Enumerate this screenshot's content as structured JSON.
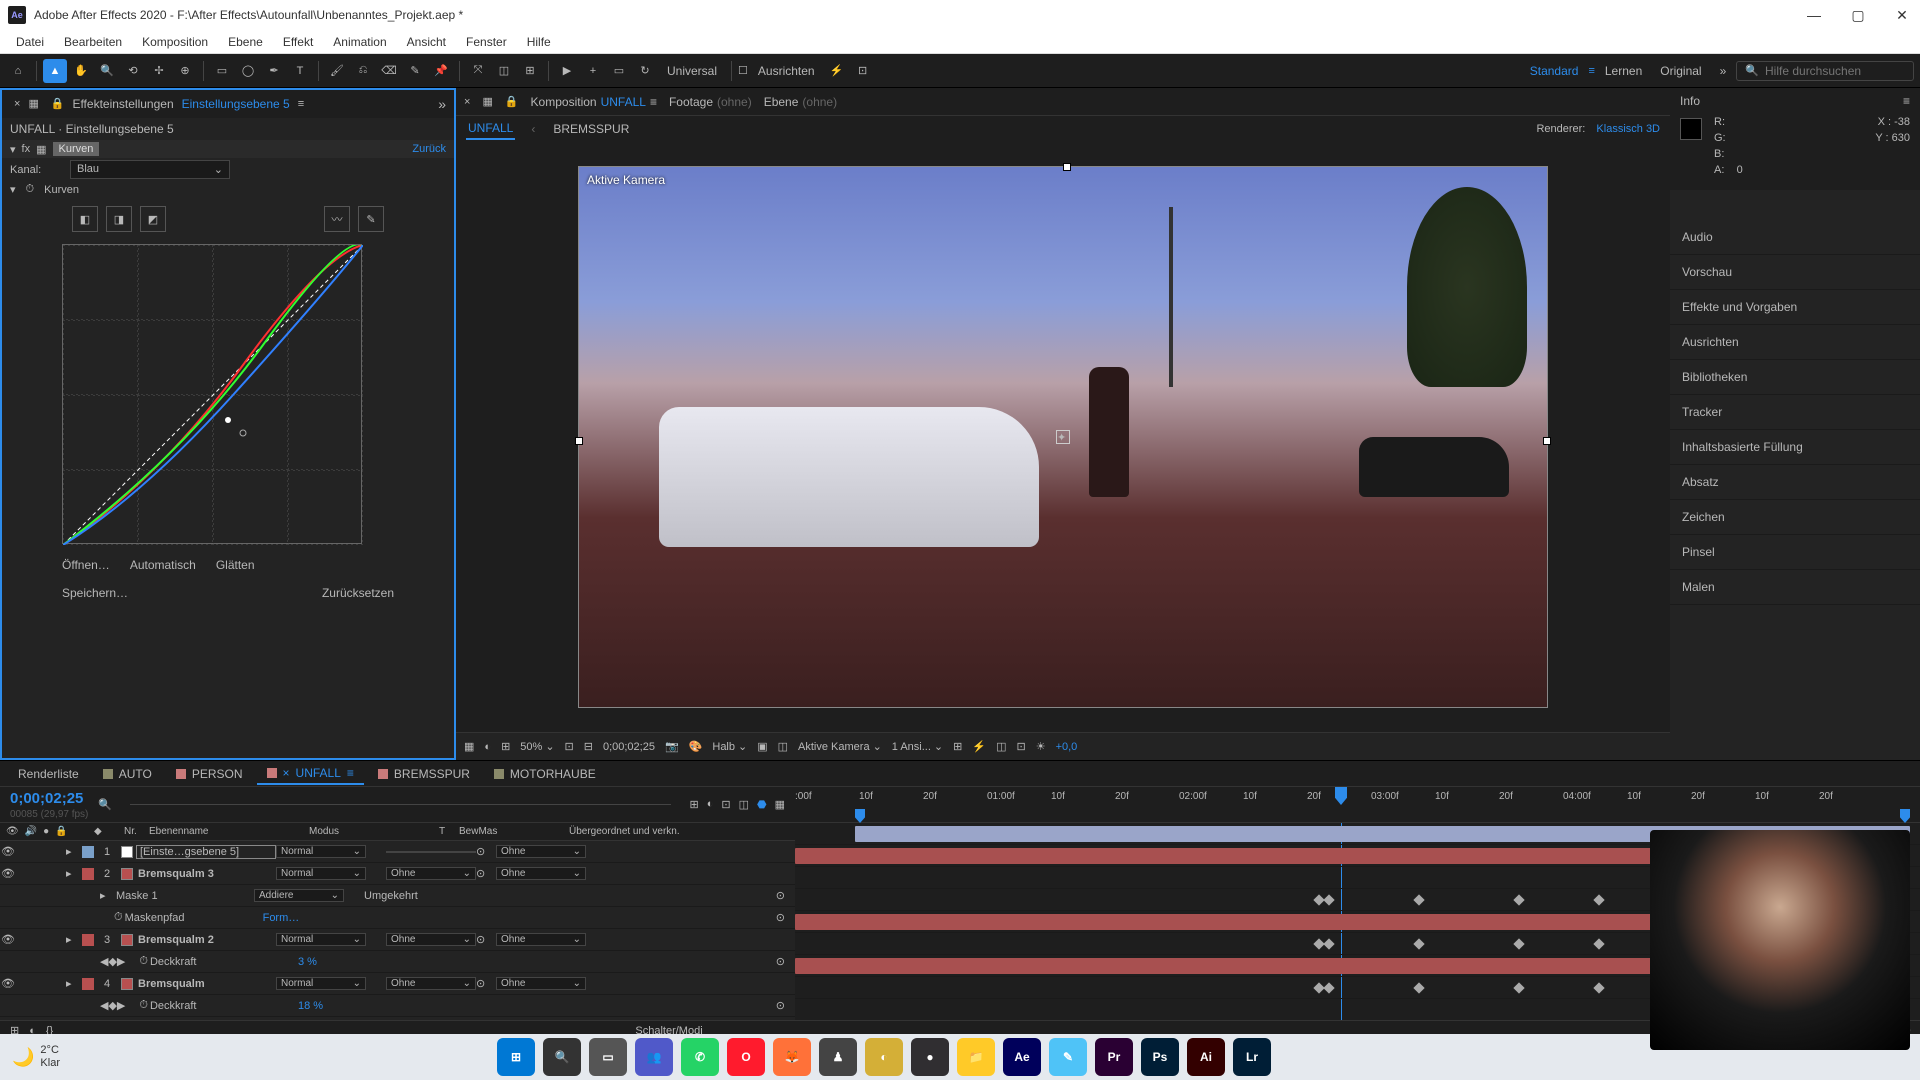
{
  "titlebar": {
    "app": "Adobe After Effects 2020",
    "path": "F:\\After Effects\\Autounfall\\Unbenanntes_Projekt.aep *"
  },
  "menubar": [
    "Datei",
    "Bearbeiten",
    "Komposition",
    "Ebene",
    "Effekt",
    "Animation",
    "Ansicht",
    "Fenster",
    "Hilfe"
  ],
  "toolbar": {
    "universal": "Universal",
    "ausrichten": "Ausrichten",
    "workspaces": [
      "Standard",
      "Lernen",
      "Original"
    ],
    "search_placeholder": "Hilfe durchsuchen"
  },
  "effects_panel": {
    "tab_label": "Effekteinstellungen",
    "tab_item": "Einstellungsebene 5",
    "breadcrumb": "UNFALL · Einstellungsebene 5",
    "fx_name": "Kurven",
    "reset": "Zurück",
    "channel_label": "Kanal:",
    "channel_value": "Blau",
    "curves_label": "Kurven",
    "actions": {
      "open": "Öffnen…",
      "auto": "Automatisch",
      "smooth": "Glätten",
      "save": "Speichern…",
      "reset": "Zurücksetzen"
    }
  },
  "comp_panel": {
    "tabs": [
      {
        "prefix": "Komposition",
        "name": "UNFALL"
      },
      {
        "prefix": "Footage",
        "name": "(ohne)"
      },
      {
        "prefix": "Ebene",
        "name": "(ohne)"
      }
    ],
    "subtabs": [
      "UNFALL",
      "BREMSSPUR"
    ],
    "renderer_label": "Renderer:",
    "renderer_value": "Klassisch 3D",
    "active_camera": "Aktive Kamera",
    "controls": {
      "zoom": "50%",
      "timecode": "0;00;02;25",
      "res": "Halb",
      "camera": "Aktive Kamera",
      "views": "1 Ansi...",
      "exposure": "+0,0"
    }
  },
  "info": {
    "title": "Info",
    "R": "R:",
    "G": "G:",
    "B": "B:",
    "A": "A:",
    "Aval": "0",
    "X": "X : -38",
    "Y": "Y : 630"
  },
  "right_panels": [
    "Audio",
    "Vorschau",
    "Effekte und Vorgaben",
    "Ausrichten",
    "Bibliotheken",
    "Tracker",
    "Inhaltsbasierte Füllung",
    "Absatz",
    "Zeichen",
    "Pinsel",
    "Malen"
  ],
  "timeline": {
    "tabs": [
      {
        "label": "Renderliste",
        "color": ""
      },
      {
        "label": "AUTO",
        "color": "#8a8a6a"
      },
      {
        "label": "PERSON",
        "color": "#c97a7a"
      },
      {
        "label": "UNFALL",
        "color": "#c97a7a",
        "active": true
      },
      {
        "label": "BREMSSPUR",
        "color": "#c97a7a"
      },
      {
        "label": "MOTORHAUBE",
        "color": "#8a8a6a"
      }
    ],
    "timecode": "0;00;02;25",
    "subtime": "00085 (29,97 fps)",
    "cols": {
      "nr": "Nr.",
      "name": "Ebenenname",
      "modus": "Modus",
      "t": "T",
      "bewmas": "BewMas",
      "parent": "Übergeordnet und verkn."
    },
    "ruler": [
      ":00f",
      "10f",
      "20f",
      "01:00f",
      "10f",
      "20f",
      "02:00f",
      "10f",
      "20f",
      "03:00f",
      "10f",
      "20f",
      "04:00f",
      "10f",
      "20f",
      "10f",
      "20f"
    ],
    "layers": [
      {
        "num": "1",
        "color": "#7aa0c9",
        "sq": "#fff",
        "name": "[Einste…gsebene 5]",
        "mode": "Normal",
        "trk": "",
        "parent": "Ohne",
        "boxed": true
      },
      {
        "num": "2",
        "color": "#b85050",
        "sq": "#b85050",
        "name": "Bremsqualm 3",
        "mode": "Normal",
        "trk": "Ohne",
        "parent": "Ohne",
        "bold": true
      },
      {
        "sub": true,
        "name": "Maske 1",
        "mode": "Addiere",
        "extra": "Umgekehrt"
      },
      {
        "sub": true,
        "icon": "path",
        "name": "Maskenpfad",
        "mode_link": "Form…"
      },
      {
        "num": "3",
        "color": "#b85050",
        "sq": "#b85050",
        "name": "Bremsqualm 2",
        "mode": "Normal",
        "trk": "Ohne",
        "parent": "Ohne",
        "bold": true
      },
      {
        "sub": true,
        "icon": "stopwatch",
        "name": "Deckkraft",
        "value": "3 %"
      },
      {
        "num": "4",
        "color": "#b85050",
        "sq": "#b85050",
        "name": "Bremsqualm",
        "mode": "Normal",
        "trk": "Ohne",
        "parent": "Ohne",
        "bold": true
      },
      {
        "sub": true,
        "icon": "stopwatch",
        "name": "Deckkraft",
        "value": "18 %"
      }
    ],
    "footer": "Schalter/Modi"
  },
  "weather": {
    "temp": "2°C",
    "desc": "Klar"
  },
  "task_apps": [
    {
      "name": "start",
      "bg": "#0078d4",
      "txt": "⊞"
    },
    {
      "name": "search",
      "bg": "#333",
      "txt": "🔍"
    },
    {
      "name": "taskview",
      "bg": "#555",
      "txt": "▭"
    },
    {
      "name": "teams",
      "bg": "#5059c9",
      "txt": "👥"
    },
    {
      "name": "whatsapp",
      "bg": "#25d366",
      "txt": "✆"
    },
    {
      "name": "opera",
      "bg": "#ff1b2d",
      "txt": "O"
    },
    {
      "name": "firefox",
      "bg": "#ff7139",
      "txt": "🦊"
    },
    {
      "name": "app1",
      "bg": "#444",
      "txt": "♟"
    },
    {
      "name": "app2",
      "bg": "#d4af37",
      "txt": "◐"
    },
    {
      "name": "obs",
      "bg": "#302e31",
      "txt": "●"
    },
    {
      "name": "explorer",
      "bg": "#ffca28",
      "txt": "📁"
    },
    {
      "name": "ae",
      "bg": "#00005b",
      "txt": "Ae"
    },
    {
      "name": "app3",
      "bg": "#4fc3f7",
      "txt": "✎"
    },
    {
      "name": "pr",
      "bg": "#2a0033",
      "txt": "Pr"
    },
    {
      "name": "ps",
      "bg": "#001e36",
      "txt": "Ps"
    },
    {
      "name": "ai",
      "bg": "#330000",
      "txt": "Ai"
    },
    {
      "name": "lr",
      "bg": "#001e36",
      "txt": "Lr"
    }
  ]
}
